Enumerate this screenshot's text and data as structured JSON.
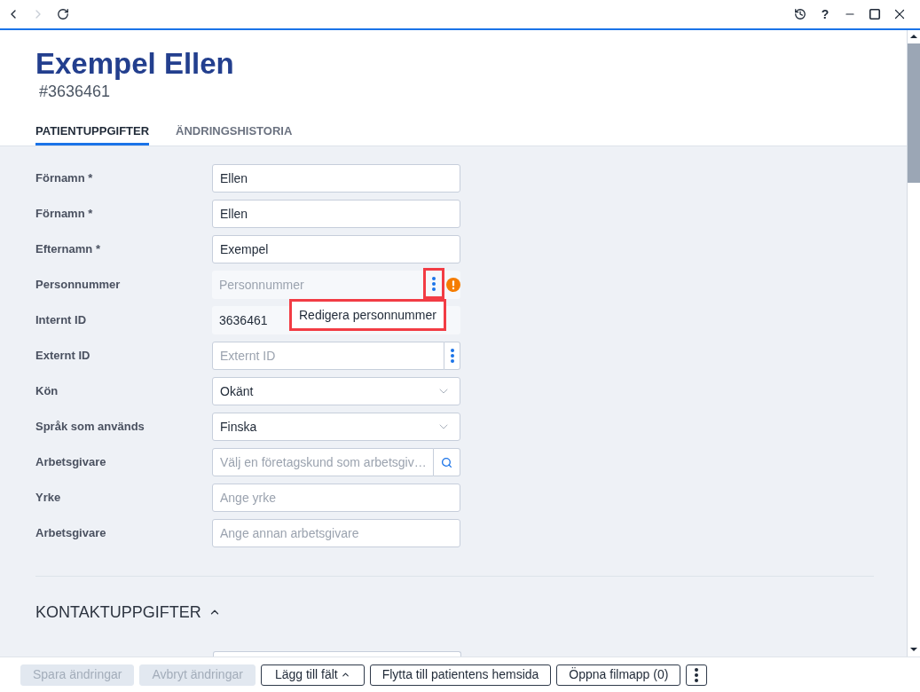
{
  "navigation": [
    {
      "kind": "back",
      "disabled": false
    },
    {
      "kind": "forward",
      "disabled": true
    },
    {
      "kind": "reload",
      "disabled": false
    }
  ],
  "window_controls": [
    {
      "kind": "history"
    },
    {
      "kind": "help",
      "label": "?"
    },
    {
      "kind": "minimize"
    },
    {
      "kind": "maximize"
    },
    {
      "kind": "close"
    }
  ],
  "patient": {
    "name": "Exempel Ellen",
    "number": "#3636461"
  },
  "tabs": [
    {
      "label": "PATIENTUPPGIFTER",
      "selected": true
    },
    {
      "label": "ÄNDRINGSHISTORIA",
      "selected": false
    }
  ],
  "fields": [
    {
      "label": "Förnamn *",
      "kind": "text",
      "value": "Ellen"
    },
    {
      "label": "Förnamn *",
      "kind": "text",
      "value": "Ellen"
    },
    {
      "label": "Efternamn *",
      "kind": "text",
      "value": "Exempel"
    },
    {
      "label": "Personnummer",
      "kind": "readonly",
      "placeholder": "Personnummer",
      "menu": {
        "highlighted": true
      },
      "warning": true,
      "tooltip": {
        "text": "Redigera personnummer",
        "highlighted": true
      }
    },
    {
      "label": "Internt ID",
      "kind": "readonly",
      "value": "3636461"
    },
    {
      "label": "Externt ID",
      "kind": "text",
      "placeholder": "Externt ID",
      "menu": {
        "highlighted": false
      }
    },
    {
      "label": "Kön",
      "kind": "select",
      "value": "Okänt"
    },
    {
      "label": "Språk som används",
      "kind": "select",
      "value": "Finska"
    },
    {
      "label": "Arbetsgivare",
      "kind": "search",
      "placeholder": "Välj en företagskund som arbetsgiv…"
    },
    {
      "label": "Yrke",
      "kind": "text",
      "placeholder": "Ange yrke"
    },
    {
      "label": "Arbetsgivare",
      "kind": "text",
      "placeholder": "Ange annan arbetsgivare"
    }
  ],
  "sections": [
    {
      "title": "KONTAKTUPPGIFTER",
      "expanded": true
    }
  ],
  "actions": [
    {
      "kind": "button",
      "label": "Spara ändringar",
      "disabled": true
    },
    {
      "kind": "button",
      "label": "Avbryt ändringar",
      "disabled": true
    },
    {
      "kind": "dropdown",
      "label": "Lägg till fält",
      "disabled": false
    },
    {
      "kind": "button",
      "label": "Flytta till patientens hemsida",
      "disabled": false
    },
    {
      "kind": "button",
      "label": "Öppna filmapp (0)",
      "disabled": false
    },
    {
      "kind": "more",
      "disabled": false
    }
  ]
}
